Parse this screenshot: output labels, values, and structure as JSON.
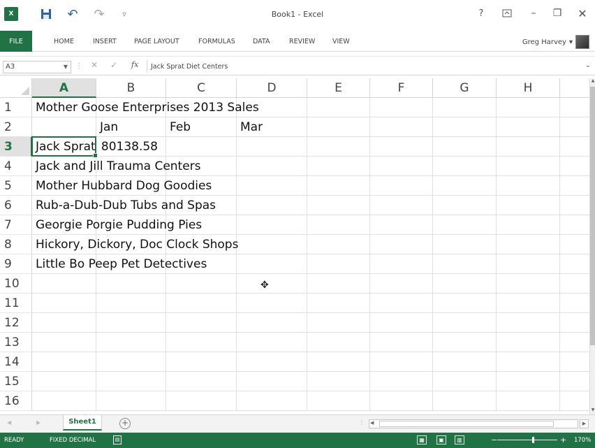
{
  "titlebar": {
    "app_logo": "X",
    "doc_title": "Book1 - Excel",
    "help": "?",
    "undo_glyph": "↶",
    "redo_glyph": "↷",
    "qat_more": "▿",
    "min_glyph": "–",
    "restore_glyph": "❐",
    "close_glyph": "✕"
  },
  "ribbon": {
    "tabs": [
      "FILE",
      "HOME",
      "INSERT",
      "PAGE LAYOUT",
      "FORMULAS",
      "DATA",
      "REVIEW",
      "VIEW"
    ],
    "user_name": "Greg Harvey",
    "user_menu": "▾",
    "accent_color": "#217346"
  },
  "formula_bar": {
    "name_box": "A3",
    "cancel": "✕",
    "enter": "✓",
    "fx": "fx",
    "formula": "Jack Sprat Diet Centers"
  },
  "grid": {
    "columns": [
      "A",
      "B",
      "C",
      "D",
      "E",
      "F",
      "G",
      "H"
    ],
    "active_column": "A",
    "rows": [
      "1",
      "2",
      "3",
      "4",
      "5",
      "6",
      "7",
      "8",
      "9",
      "10",
      "11",
      "12",
      "13",
      "14",
      "15",
      "16"
    ],
    "active_row": "3",
    "cells": {
      "A1": "Mother Goose Enterprises 2013 Sales",
      "B2": "Jan",
      "C2": "Feb",
      "D2": "Mar",
      "A3": "Jack Sprat",
      "B3": "80138.58",
      "A4": "Jack and Jill Trauma Centers",
      "A5": "Mother Hubbard Dog Goodies",
      "A6": "Rub-a-Dub-Dub Tubs and Spas",
      "A7": "Georgie Porgie Pudding Pies",
      "A8": "Hickory, Dickory, Doc Clock Shops",
      "A9": "Little Bo Peep Pet Detectives"
    },
    "selected_cell": "A3",
    "cursor_icon": "plus-cursor-icon"
  },
  "sheets": {
    "tabs": [
      "Sheet1"
    ],
    "active": "Sheet1",
    "add_label": "+"
  },
  "statusbar": {
    "mode": "READY",
    "fixed_decimal": "FIXED DECIMAL",
    "zoom": "170%"
  }
}
